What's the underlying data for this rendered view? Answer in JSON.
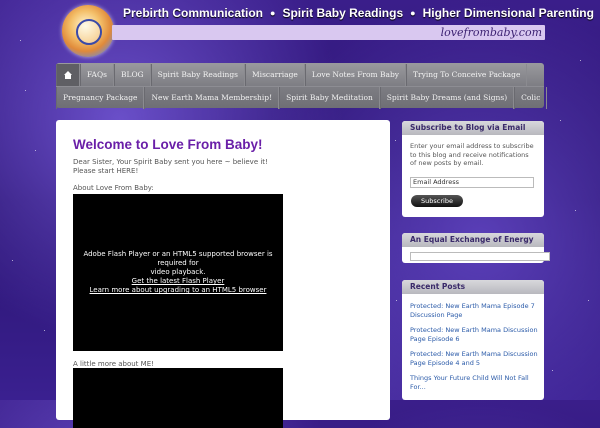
{
  "header": {
    "taglines": [
      "Prebirth Communication",
      "Spirit Baby Readings",
      "Higher Dimensional Parenting"
    ],
    "separator": "●",
    "site_url": "lovefrombaby.com"
  },
  "nav": {
    "row1": [
      "FAQs",
      "BLOG",
      "Spirit Baby Readings",
      "Miscarriage",
      "Love Notes From Baby",
      "Trying To Conceive Package"
    ],
    "row2": [
      "Pregnancy Package",
      "New Earth Mama Membership!",
      "Spirit Baby Meditation",
      "Spirit Baby Dreams (and Signs)",
      "Colic"
    ]
  },
  "main": {
    "title": "Welcome to Love From Baby!",
    "intro_line1": "Dear Sister, Your Spirit Baby sent you here ~ believe it!",
    "intro_line2": "Please start HERE!",
    "about_label": "About Love From Baby:",
    "video_msg1": "Adobe Flash Player or an HTML5 supported browser is required for",
    "video_msg2": "video playback.",
    "video_link1": "Get the latest Flash Player",
    "video_link2": "Learn more about upgrading to an HTML5 browser",
    "more_label": "A little more about ME!"
  },
  "sidebar": {
    "subscribe": {
      "title": "Subscribe to Blog via Email",
      "description": "Enter your email address to subscribe to this blog and receive notifications of new posts by email.",
      "email_placeholder": "Email Address",
      "button": "Subscribe"
    },
    "exchange": {
      "title": "An Equal Exchange of Energy"
    },
    "recent": {
      "title": "Recent Posts",
      "posts": [
        "Protected: New Earth Mama Episode 7 Discussion Page",
        "Protected: New Earth Mama Discussion Page Episode 6",
        "Protected: New Earth Mama Discussion Page Episode 4 and 5",
        "Things Your Future Child Will Not Fall For..."
      ]
    }
  }
}
